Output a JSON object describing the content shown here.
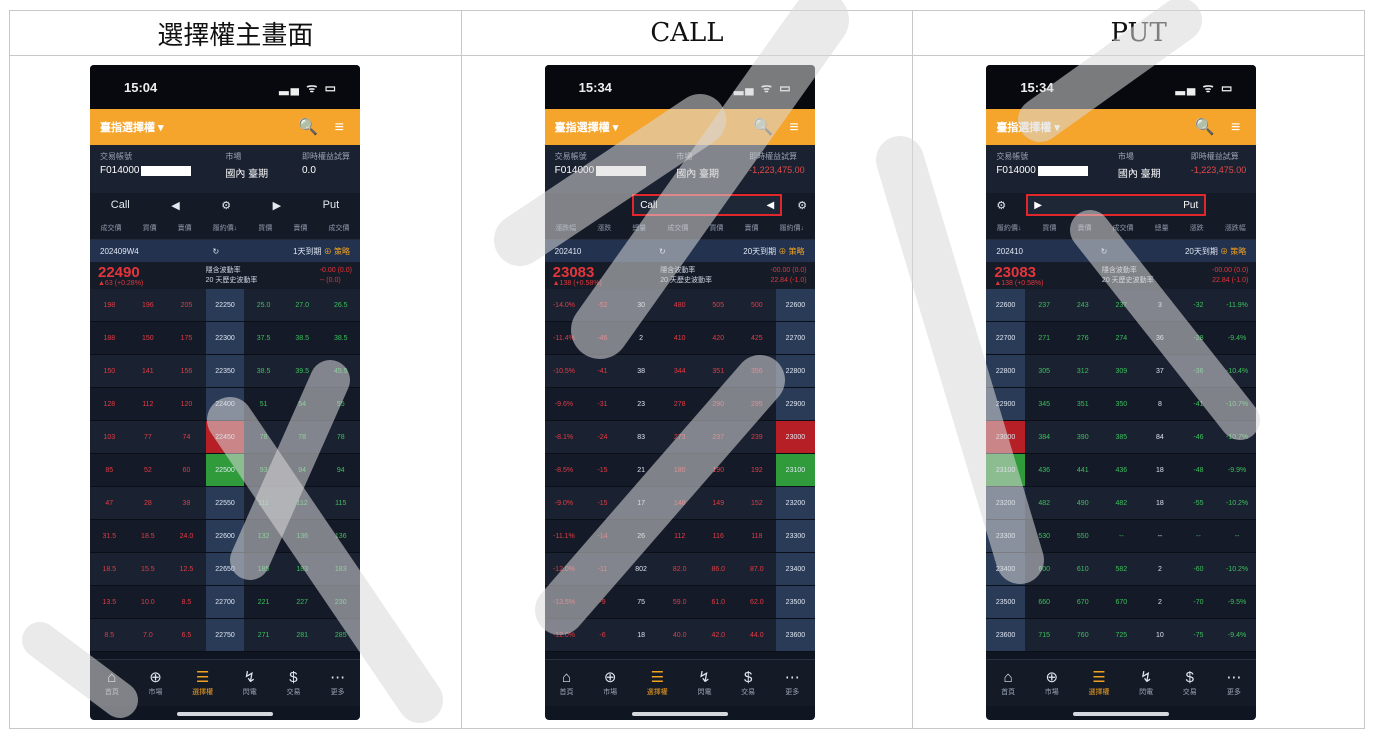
{
  "headers": {
    "col1": "選擇權主畫面",
    "col2": "CALL",
    "col3": "PUT"
  },
  "colors": {
    "orange": "#f5a42c",
    "red": "#e5353c",
    "green": "#3cc05b",
    "highlight_border": "#e1262c"
  },
  "screens": [
    {
      "time": "15:04",
      "signal_icons": "▂▄ ᯤ ▭",
      "menu_title": "臺指選擇權 ▾",
      "toolbar_icons": "🔍 ≡",
      "account_label": "交易帳號",
      "account_value": "F014000",
      "market_label": "市場",
      "market_value": "國內 臺期",
      "margin_label": "即時權益試算",
      "margin_value": "0.0",
      "selector": {
        "left": "Call",
        "arrow_l": "◀",
        "gear": "⚙",
        "arrow_r": "▶",
        "right": "Put"
      },
      "col_headers": [
        "成交價",
        "買價",
        "賣價",
        "履約價↓",
        "買價",
        "賣價",
        "成交價"
      ],
      "expiry": "202409W4",
      "refresh": "↻",
      "days": "1天到期",
      "more_label": "⊕ 策略",
      "price": "22490",
      "price_change": "▲63 (+0.28%)",
      "iv_label": "隱含波動率",
      "iv_value": "-0.00 (0.0)",
      "hv_label": "20 天歷史波動率",
      "hv_value": "-- (0.0)",
      "rows": [
        {
          "c": [
            "198",
            "196",
            "205"
          ],
          "s": "22250",
          "p": [
            "25.0",
            "27.0",
            "26.5"
          ],
          "atm": ""
        },
        {
          "c": [
            "188",
            "150",
            "175"
          ],
          "s": "22300",
          "p": [
            "37.5",
            "38.5",
            "38.5"
          ],
          "atm": ""
        },
        {
          "c": [
            "150",
            "141",
            "156"
          ],
          "s": "22350",
          "p": [
            "38.5",
            "39.5",
            "45.5"
          ],
          "atm": ""
        },
        {
          "c": [
            "128",
            "112",
            "120"
          ],
          "s": "22400",
          "p": [
            "51",
            "54",
            "55"
          ],
          "atm": ""
        },
        {
          "c": [
            "103",
            "77",
            "74"
          ],
          "s": "22450",
          "p": [
            "78",
            "78",
            "78"
          ],
          "atm": "r"
        },
        {
          "c": [
            "85",
            "52",
            "60"
          ],
          "s": "22500",
          "p": [
            "93",
            "94",
            "94"
          ],
          "atm": "g"
        },
        {
          "c": [
            "47",
            "28",
            "38"
          ],
          "s": "22550",
          "p": [
            "111",
            "112",
            "115"
          ],
          "atm": ""
        },
        {
          "c": [
            "31.5",
            "18.5",
            "24.0"
          ],
          "s": "22600",
          "p": [
            "132",
            "136",
            "136"
          ],
          "atm": ""
        },
        {
          "c": [
            "18.5",
            "15.5",
            "12.5"
          ],
          "s": "22650",
          "p": [
            "185",
            "183",
            "183"
          ],
          "atm": ""
        },
        {
          "c": [
            "13.5",
            "10.0",
            "8.5"
          ],
          "s": "22700",
          "p": [
            "221",
            "227",
            "230"
          ],
          "atm": ""
        },
        {
          "c": [
            "8.5",
            "7.0",
            "6.5"
          ],
          "s": "22750",
          "p": [
            "271",
            "281",
            "285"
          ],
          "atm": ""
        }
      ],
      "nav": [
        {
          "icon": "⌂",
          "label": "首頁"
        },
        {
          "icon": "⊕",
          "label": "市場"
        },
        {
          "icon": "☰",
          "label": "選擇權"
        },
        {
          "icon": "↯",
          "label": "閃電"
        },
        {
          "icon": "$",
          "label": "交易"
        },
        {
          "icon": "⋯",
          "label": "更多"
        }
      ]
    },
    {
      "time": "15:34",
      "signal_icons": "▂▄ ᯤ ▭",
      "menu_title": "臺指選擇權 ▾",
      "toolbar_icons": "🔍 ≡",
      "account_label": "交易帳號",
      "account_value": "F014000",
      "market_label": "市場",
      "market_value": "國內 臺期",
      "margin_label": "即時權益試算",
      "margin_value": "-1,223,475.00",
      "selector": {
        "left": "Call",
        "arrow": "◀",
        "gear": "⚙"
      },
      "col_headers": [
        "漲跌幅",
        "漲跌",
        "總量",
        "成交價",
        "買價",
        "賣價",
        "履約價↓"
      ],
      "expiry": "202410",
      "refresh": "↻",
      "days": "20天到期",
      "more_label": "⊕ 策略",
      "price": "23083",
      "price_change": "▲138 (+0.58%)",
      "iv_label": "隱含波動率",
      "iv_value": "-00.00 (0.0)",
      "hv_label": "20 天歷史波動率",
      "hv_value": "22.84 (-1.0)",
      "rows": [
        {
          "c": [
            "-14.0%",
            "-52",
            "30"
          ],
          "s": "22600",
          "p": [
            "480",
            "505",
            "500"
          ],
          "atm": ""
        },
        {
          "c": [
            "-11.4%",
            "-46",
            "2"
          ],
          "s": "22700",
          "p": [
            "410",
            "420",
            "425"
          ],
          "atm": ""
        },
        {
          "c": [
            "-10.5%",
            "-41",
            "38"
          ],
          "s": "22800",
          "p": [
            "344",
            "351",
            "356"
          ],
          "atm": ""
        },
        {
          "c": [
            "-9.6%",
            "-31",
            "23"
          ],
          "s": "22900",
          "p": [
            "278",
            "290",
            "295"
          ],
          "atm": ""
        },
        {
          "c": [
            "-8.1%",
            "-24",
            "83"
          ],
          "s": "23000",
          "p": [
            "273",
            "237",
            "239"
          ],
          "atm": "r"
        },
        {
          "c": [
            "-8.5%",
            "-15",
            "21"
          ],
          "s": "23100",
          "p": [
            "180",
            "190",
            "192"
          ],
          "atm": "g"
        },
        {
          "c": [
            "-9.0%",
            "-15",
            "17"
          ],
          "s": "23200",
          "p": [
            "148",
            "149",
            "152"
          ],
          "atm": ""
        },
        {
          "c": [
            "-11.1%",
            "-14",
            "26"
          ],
          "s": "23300",
          "p": [
            "112",
            "116",
            "118"
          ],
          "atm": ""
        },
        {
          "c": [
            "-12.0%",
            "-11",
            "802"
          ],
          "s": "23400",
          "p": [
            "82.0",
            "86.0",
            "87.0"
          ],
          "atm": ""
        },
        {
          "c": [
            "-13.5%",
            "-9",
            "75"
          ],
          "s": "23500",
          "p": [
            "59.0",
            "61.0",
            "62.0"
          ],
          "atm": ""
        },
        {
          "c": [
            "-12.0%",
            "-6",
            "18"
          ],
          "s": "23600",
          "p": [
            "40.0",
            "42.0",
            "44.0"
          ],
          "atm": ""
        }
      ],
      "nav": [
        {
          "icon": "⌂",
          "label": "首頁"
        },
        {
          "icon": "⊕",
          "label": "市場"
        },
        {
          "icon": "☰",
          "label": "選擇權"
        },
        {
          "icon": "↯",
          "label": "閃電"
        },
        {
          "icon": "$",
          "label": "交易"
        },
        {
          "icon": "⋯",
          "label": "更多"
        }
      ]
    },
    {
      "time": "15:34",
      "signal_icons": "▂▄ ᯤ ▭",
      "menu_title": "臺指選擇權 ▾",
      "toolbar_icons": "🔍 ≡",
      "account_label": "交易帳號",
      "account_value": "F014000",
      "market_label": "市場",
      "market_value": "國內 臺期",
      "margin_label": "即時權益試算",
      "margin_value": "-1,223,475.00",
      "selector": {
        "gear": "⚙",
        "arrow": "▶",
        "right": "Put"
      },
      "col_headers": [
        "履約價↓",
        "買價",
        "賣價",
        "成交價",
        "總量",
        "漲跌",
        "漲跌幅"
      ],
      "expiry": "202410",
      "refresh": "↻",
      "days": "20天到期",
      "more_label": "⊕ 策略",
      "price": "23083",
      "price_change": "▲138 (+0.58%)",
      "iv_label": "隱含波動率",
      "iv_value": "-00.00 (0.0)",
      "hv_label": "20 天歷史波動率",
      "hv_value": "22.84 (-1.0)",
      "rows": [
        {
          "s": "22600",
          "p": [
            "237",
            "243",
            "237",
            "3",
            "-32",
            "-11.9%"
          ],
          "atm": ""
        },
        {
          "s": "22700",
          "p": [
            "271",
            "276",
            "274",
            "36",
            "-28",
            "-9.4%"
          ],
          "atm": ""
        },
        {
          "s": "22800",
          "p": [
            "305",
            "312",
            "309",
            "37",
            "-36",
            "-10.4%"
          ],
          "atm": ""
        },
        {
          "s": "22900",
          "p": [
            "345",
            "351",
            "350",
            "8",
            "-41",
            "-10.7%"
          ],
          "atm": ""
        },
        {
          "s": "23000",
          "p": [
            "384",
            "390",
            "385",
            "84",
            "-46",
            "-10.7%"
          ],
          "atm": "r"
        },
        {
          "s": "23100",
          "p": [
            "436",
            "441",
            "436",
            "18",
            "-48",
            "-9.9%"
          ],
          "atm": "g"
        },
        {
          "s": "23200",
          "p": [
            "482",
            "490",
            "482",
            "18",
            "-55",
            "-10.2%"
          ],
          "atm": ""
        },
        {
          "s": "23300",
          "p": [
            "530",
            "550",
            "--",
            "--",
            "--",
            "--"
          ],
          "atm": ""
        },
        {
          "s": "23400",
          "p": [
            "600",
            "610",
            "582",
            "2",
            "-60",
            "-10.2%"
          ],
          "atm": ""
        },
        {
          "s": "23500",
          "p": [
            "660",
            "670",
            "670",
            "2",
            "-70",
            "-9.5%"
          ],
          "atm": ""
        },
        {
          "s": "23600",
          "p": [
            "715",
            "760",
            "725",
            "10",
            "-75",
            "-9.4%"
          ],
          "atm": ""
        }
      ],
      "nav": [
        {
          "icon": "⌂",
          "label": "首頁"
        },
        {
          "icon": "⊕",
          "label": "市場"
        },
        {
          "icon": "☰",
          "label": "選擇權"
        },
        {
          "icon": "↯",
          "label": "閃電"
        },
        {
          "icon": "$",
          "label": "交易"
        },
        {
          "icon": "⋯",
          "label": "更多"
        }
      ]
    }
  ]
}
